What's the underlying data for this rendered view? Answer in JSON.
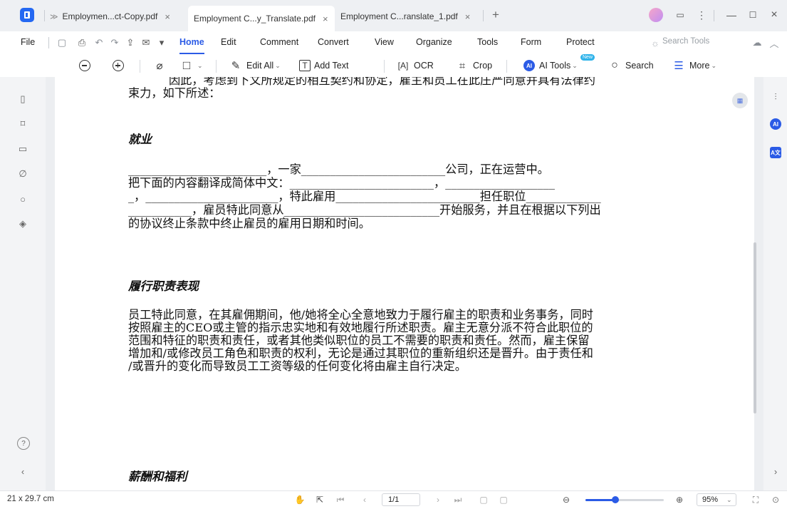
{
  "tabs": [
    {
      "label": "Employmen...ct-Copy.pdf",
      "active": false
    },
    {
      "label": "Employment C...y_Translate.pdf",
      "active": true
    },
    {
      "label": "Employment C...ranslate_1.pdf",
      "active": false
    }
  ],
  "menu": {
    "file": "File",
    "items": [
      "Home",
      "Edit",
      "Comment",
      "Convert",
      "View",
      "Organize",
      "Tools",
      "Form",
      "Protect"
    ],
    "active": "Home",
    "search_tools": "Search Tools"
  },
  "toolbar": {
    "edit_all": "Edit All",
    "add_text": "Add Text",
    "ocr": "OCR",
    "crop": "Crop",
    "ai_tools": "AI Tools",
    "ai_badge": "AI",
    "new_badge": "New",
    "search": "Search",
    "more": "More"
  },
  "document": {
    "line_top_partial": "因此，考虑到下文所规定的相互契约和协定，雇主和员工在此庄严同意并具有法律约",
    "line_top": "束力，如下所述：",
    "h1": "就业",
    "p1": [
      "________________________，一家_________________________公司，正在运营中。",
      "把下面的内容翻译成简体中文：_________________________，___________________",
      "_，_______________________，特此雇用_________________________担任职位_____________",
      "___________，雇员特此同意从___________________________开始服务，并且在根据以下列出",
      "的协议终止条款中终止雇员的雇用日期和时间。"
    ],
    "h2": "履行职责表现",
    "p2": [
      "员工特此同意，在其雇佣期间，他/她将全心全意地致力于履行雇主的职责和业务事务，同时",
      "按照雇主的CEO或主管的指示忠实地和有效地履行所述职责。雇主无意分派不符合此职位的",
      "范围和特征的职责和责任，或者其他类似职位的员工不需要的职责和责任。然而，雇主保留",
      "增加和/或修改员工角色和职责的权利，无论是通过其职位的重新组织还是晋升。由于责任和",
      "/或晋升的变化而导致员工工资等级的任何变化将由雇主自行决定。"
    ],
    "h3": "薪酬和福利"
  },
  "status": {
    "page_size": "21 x 29.7 cm",
    "page_indicator": "1/1",
    "zoom": "95%",
    "zoom_fraction": 0.38
  },
  "colors": {
    "accent": "#2b5be6"
  }
}
